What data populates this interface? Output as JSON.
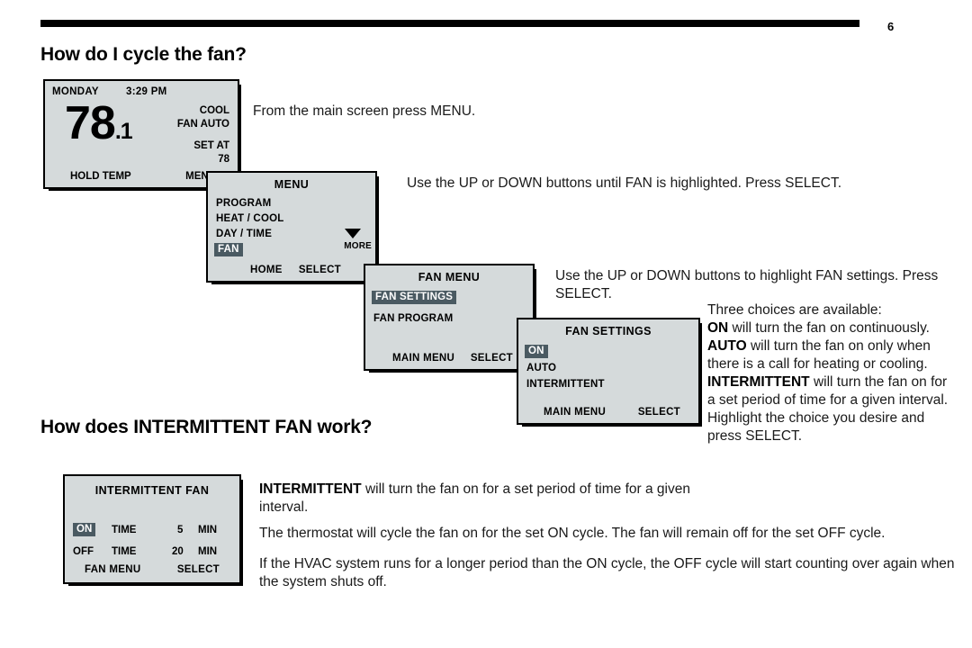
{
  "page": {
    "page_number": "6"
  },
  "headings": {
    "q1": "How do I cycle the fan?",
    "q2": "How does INTERMITTENT FAN work?"
  },
  "instructions": {
    "press_menu": "From the main screen press MENU.",
    "updown_fan": "Use the UP or DOWN buttons until FAN is highlighted. Press SELECT.",
    "updown_fan_settings": "Use the UP or DOWN buttons to highlight FAN settings. Press SELECT."
  },
  "choices_block": {
    "intro": "Three choices are available:",
    "on_label": "ON",
    "on_text": " will turn the fan on continuously.",
    "auto_label": "AUTO",
    "auto_text": " will turn the fan on only when there is a call for heating or cooling.",
    "intermittent_label": "INTERMITTENT",
    "intermittent_text": " will turn the fan on for a set period of time for a given interval. Highlight the choice you desire and press SELECT."
  },
  "intermittent_section": {
    "p1_label": "INTERMITTENT",
    "p1_text": " will turn the fan on for a set period of time for a given interval.",
    "p2": "The thermostat will cycle the fan on for the set ON cycle. The fan will remain off for the set OFF cycle.",
    "p3": "If the HVAC system runs for a longer period than the ON cycle, the OFF cycle will start counting over again when the system shuts off."
  },
  "screens": {
    "main": {
      "day": "MONDAY",
      "time": "3:29 PM",
      "temp_whole": "78",
      "temp_decimal": ".1",
      "mode": "COOL",
      "fan_mode": "FAN AUTO",
      "set_at_label": "SET AT",
      "set_at_value": "78",
      "softkey_left": "HOLD TEMP",
      "softkey_right": "MENU"
    },
    "menu": {
      "title": "MENU",
      "items": [
        {
          "label": "PROGRAM",
          "highlighted": false
        },
        {
          "label": "HEAT / COOL",
          "highlighted": false
        },
        {
          "label": "DAY / TIME",
          "highlighted": false
        },
        {
          "label": "FAN",
          "highlighted": true
        }
      ],
      "more_label": "MORE",
      "more_icon": "chevron-down-icon",
      "softkey_left": "HOME",
      "softkey_right": "SELECT"
    },
    "fan_menu": {
      "title": "FAN MENU",
      "items": [
        {
          "label": "FAN SETTINGS",
          "highlighted": true
        },
        {
          "label": "FAN PROGRAM",
          "highlighted": false
        }
      ],
      "softkey_left": "MAIN MENU",
      "softkey_right": "SELECT"
    },
    "fan_settings": {
      "title": "FAN SETTINGS",
      "items": [
        {
          "label": "ON",
          "highlighted": true
        },
        {
          "label": "AUTO",
          "highlighted": false
        },
        {
          "label": "INTERMITTENT",
          "highlighted": false
        }
      ],
      "softkey_left": "MAIN MENU",
      "softkey_right": "SELECT"
    },
    "intermittent_fan": {
      "title": "INTERMITTENT FAN",
      "on_label": "ON",
      "on_time_label": "TIME",
      "on_time_value": "5",
      "on_time_unit": "MIN",
      "off_label": "OFF",
      "off_time_label": "TIME",
      "off_time_value": "20",
      "off_time_unit": "MIN",
      "softkey_left": "FAN MENU",
      "softkey_right": "SELECT"
    }
  },
  "colors": {
    "lcd_background": "#d5dadb",
    "lcd_highlight": "#4a5a62",
    "ink": "#000000"
  }
}
